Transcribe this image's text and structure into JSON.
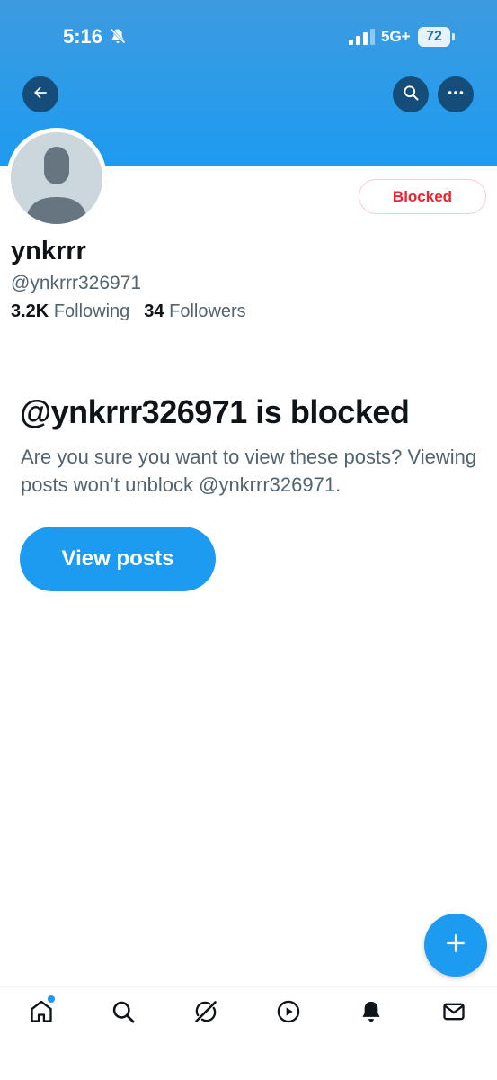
{
  "status_bar": {
    "time": "5:16",
    "network": "5G+",
    "battery": "72",
    "icons": [
      "bell-slash-icon",
      "signal-icon"
    ]
  },
  "header": {
    "icons": [
      "back-arrow-icon",
      "search-icon",
      "more-icon"
    ],
    "banner_color": "#1d9bf0"
  },
  "profile": {
    "display_name": "ynkrrr",
    "handle": "@ynkrrr326971",
    "following_count": "3.2K",
    "following_label": "Following",
    "followers_count": "34",
    "followers_label": "Followers",
    "blocked_button_label": "Blocked"
  },
  "blocked_notice": {
    "title": "@ynkrrr326971 is blocked",
    "description": "Are you sure you want to view these posts? Viewing posts won’t unblock @ynkrrr326971.",
    "view_posts_label": "View posts"
  },
  "fab": {
    "icon": "plus-icon"
  },
  "tab_bar": {
    "items": [
      "home-icon",
      "search-icon",
      "grok-icon",
      "video-icon",
      "notifications-icon",
      "messages-icon"
    ],
    "active": "home-icon"
  },
  "colors": {
    "accent": "#1d9bf0",
    "blocked_red": "#f4212e",
    "secondary_text": "#536471"
  }
}
